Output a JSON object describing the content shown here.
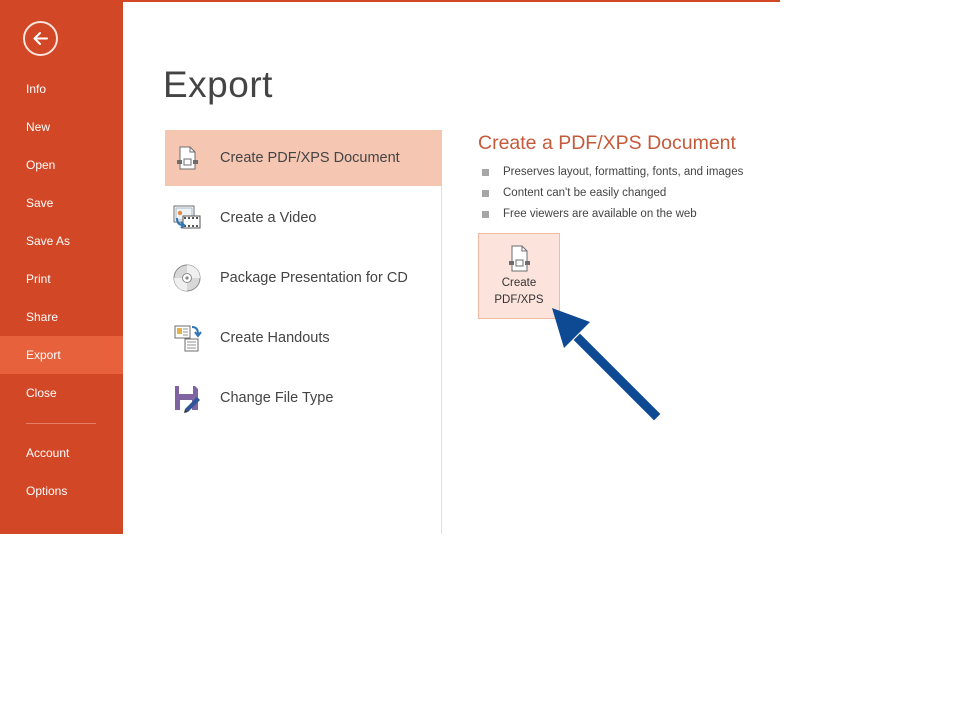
{
  "sidebar": {
    "back_icon": "back-arrow-icon",
    "items": [
      {
        "label": "Info",
        "active": false
      },
      {
        "label": "New",
        "active": false
      },
      {
        "label": "Open",
        "active": false
      },
      {
        "label": "Save",
        "active": false
      },
      {
        "label": "Save As",
        "active": false
      },
      {
        "label": "Print",
        "active": false
      },
      {
        "label": "Share",
        "active": false
      },
      {
        "label": "Export",
        "active": true
      },
      {
        "label": "Close",
        "active": false
      }
    ],
    "bottom_items": [
      {
        "label": "Account"
      },
      {
        "label": "Options"
      }
    ]
  },
  "main": {
    "title": "Export",
    "options": [
      {
        "label": "Create PDF/XPS Document",
        "icon": "pdf-document-icon",
        "selected": true
      },
      {
        "label": "Create a Video",
        "icon": "video-icon",
        "selected": false
      },
      {
        "label": "Package Presentation for CD",
        "icon": "cd-icon",
        "selected": false
      },
      {
        "label": "Create Handouts",
        "icon": "handouts-icon",
        "selected": false
      },
      {
        "label": "Change File Type",
        "icon": "save-as-filetype-icon",
        "selected": false
      }
    ],
    "detail": {
      "title": "Create a PDF/XPS Document",
      "bullets": [
        "Preserves layout, formatting, fonts, and images",
        "Content can't be easily changed",
        "Free viewers are available on the web"
      ],
      "button": {
        "line1": "Create",
        "line2": "PDF/XPS",
        "icon": "pdf-document-icon"
      }
    }
  },
  "annotation": {
    "type": "arrow",
    "color": "#0d4a93",
    "points_to": "create-pdf-xps-button"
  },
  "colors": {
    "accent": "#d24726",
    "active_nav": "#e8613d",
    "selected_option": "#f5c6b2",
    "detail_title": "#c55a3a"
  }
}
